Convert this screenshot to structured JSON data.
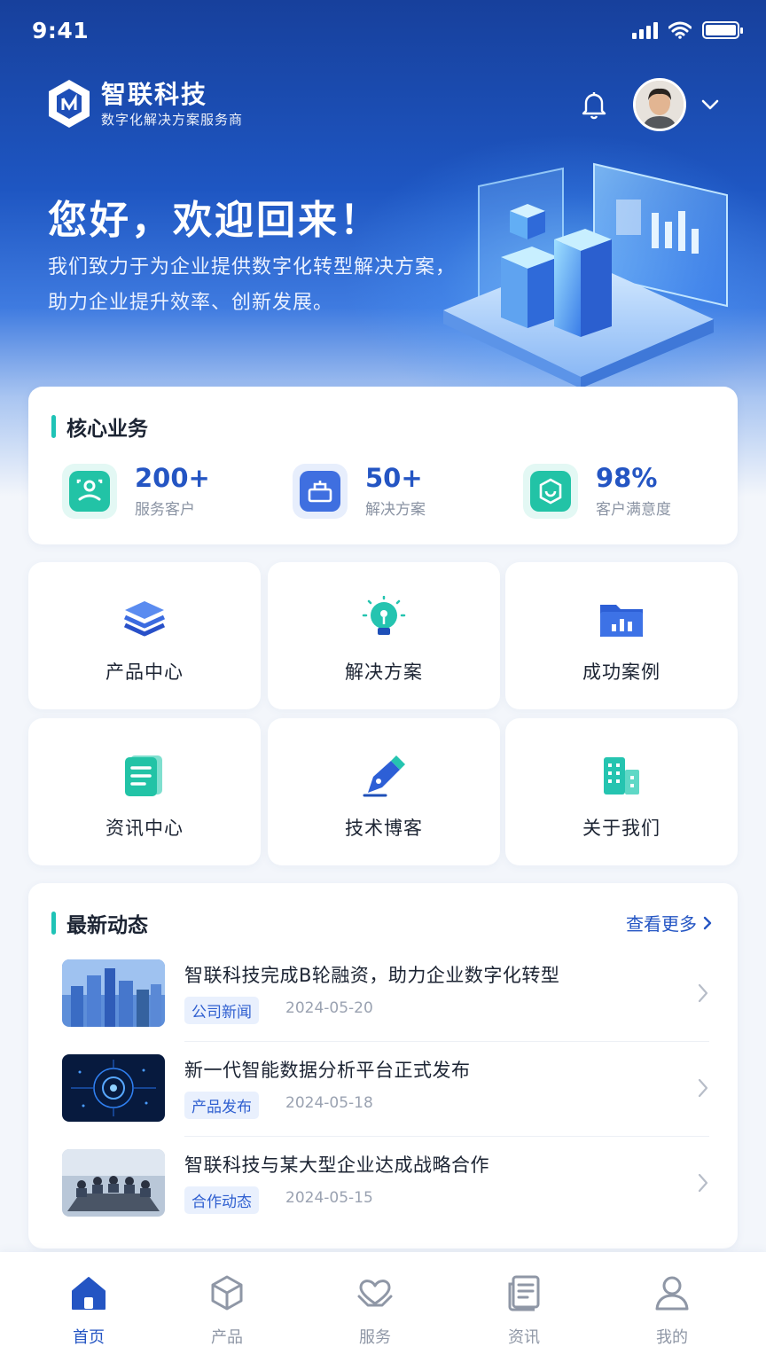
{
  "status_bar": {
    "time": "9:41"
  },
  "brand": {
    "name": "智联科技",
    "tagline": "数字化解决方案服务商",
    "logo_icon": "hexagon-logo-icon"
  },
  "header": {
    "bell_icon": "bell-icon",
    "chevron_icon": "chevron-down-icon"
  },
  "hero": {
    "greeting": "您好，欢迎回来！",
    "intro_line1": "我们致力于为企业提供数字化转型解决方案，",
    "intro_line2": "助力企业提升效率、创新发展。"
  },
  "core": {
    "title": "核心业务",
    "stats": [
      {
        "value": "200+",
        "label": "服务客户",
        "icon": "customers-icon"
      },
      {
        "value": "50+",
        "label": "解决方案",
        "icon": "solutions-icon"
      },
      {
        "value": "98%",
        "label": "客户满意度",
        "icon": "satisfaction-icon"
      }
    ]
  },
  "tiles": [
    {
      "label": "产品中心",
      "icon": "layers-icon"
    },
    {
      "label": "解决方案",
      "icon": "lightbulb-icon"
    },
    {
      "label": "成功案例",
      "icon": "chart-folder-icon"
    },
    {
      "label": "资讯中心",
      "icon": "document-icon"
    },
    {
      "label": "技术博客",
      "icon": "pen-icon"
    },
    {
      "label": "关于我们",
      "icon": "building-icon"
    }
  ],
  "news": {
    "title": "最新动态",
    "more": "查看更多",
    "items": [
      {
        "title": "智联科技完成B轮融资，助力企业数字化转型",
        "tag": "公司新闻",
        "date": "2024-05-20"
      },
      {
        "title": "新一代智能数据分析平台正式发布",
        "tag": "产品发布",
        "date": "2024-05-18"
      },
      {
        "title": "智联科技与某大型企业达成战略合作",
        "tag": "合作动态",
        "date": "2024-05-15"
      }
    ]
  },
  "tabbar": {
    "tabs": [
      {
        "label": "首页",
        "icon": "home-icon",
        "active": true
      },
      {
        "label": "产品",
        "icon": "cube-icon",
        "active": false
      },
      {
        "label": "服务",
        "icon": "heart-hands-icon",
        "active": false
      },
      {
        "label": "资讯",
        "icon": "news-icon",
        "active": false
      },
      {
        "label": "我的",
        "icon": "user-icon",
        "active": false
      }
    ]
  },
  "colors": {
    "primary": "#2455c3",
    "accent": "#1fc3b6",
    "hero_top": "#17409c"
  }
}
